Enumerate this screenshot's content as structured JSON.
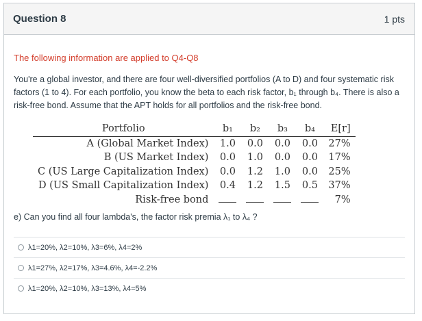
{
  "question": {
    "title": "Question 8",
    "points": "1 pts"
  },
  "intro": "The following information are applied to Q4-Q8",
  "paragraph": "You're a global investor, and there are four well-diversified portfolios (A to D) and four systematic risk factors (1 to 4). For each portfolio, you know the beta to each risk factor, b₁ through b₄. There is also a risk-free bond. Assume that the APT holds for all portfolios and the risk-free bond.",
  "table": {
    "headers": [
      "Portfolio",
      "b₁",
      "b₂",
      "b₃",
      "b₄",
      "E[r]"
    ],
    "rows": [
      {
        "name": "A (Global Market Index)",
        "b1": "1.0",
        "b2": "0.0",
        "b3": "0.0",
        "b4": "0.0",
        "er": "27%"
      },
      {
        "name": "B (US Market Index)",
        "b1": "0.0",
        "b2": "1.0",
        "b3": "0.0",
        "b4": "0.0",
        "er": "17%"
      },
      {
        "name": "C (US Large Capitalization Index)",
        "b1": "0.0",
        "b2": "1.2",
        "b3": "1.0",
        "b4": "0.0",
        "er": "25%"
      },
      {
        "name": "D (US Small Capitalization Index)",
        "b1": "0.4",
        "b2": "1.2",
        "b3": "1.5",
        "b4": "0.5",
        "er": "37%"
      },
      {
        "name": "Risk-free bond",
        "er": "7%"
      }
    ]
  },
  "prompt": "e) Can you find all four lambda's, the factor risk premia λ₁ to λ₄ ?",
  "answers": [
    "λ1=20%, λ2=10%, λ3=6%, λ4=2%",
    "λ1=27%, λ2=17%, λ3=4.6%, λ4=-2.2%",
    "λ1=20%, λ2=10%, λ3=13%, λ4=5%"
  ]
}
